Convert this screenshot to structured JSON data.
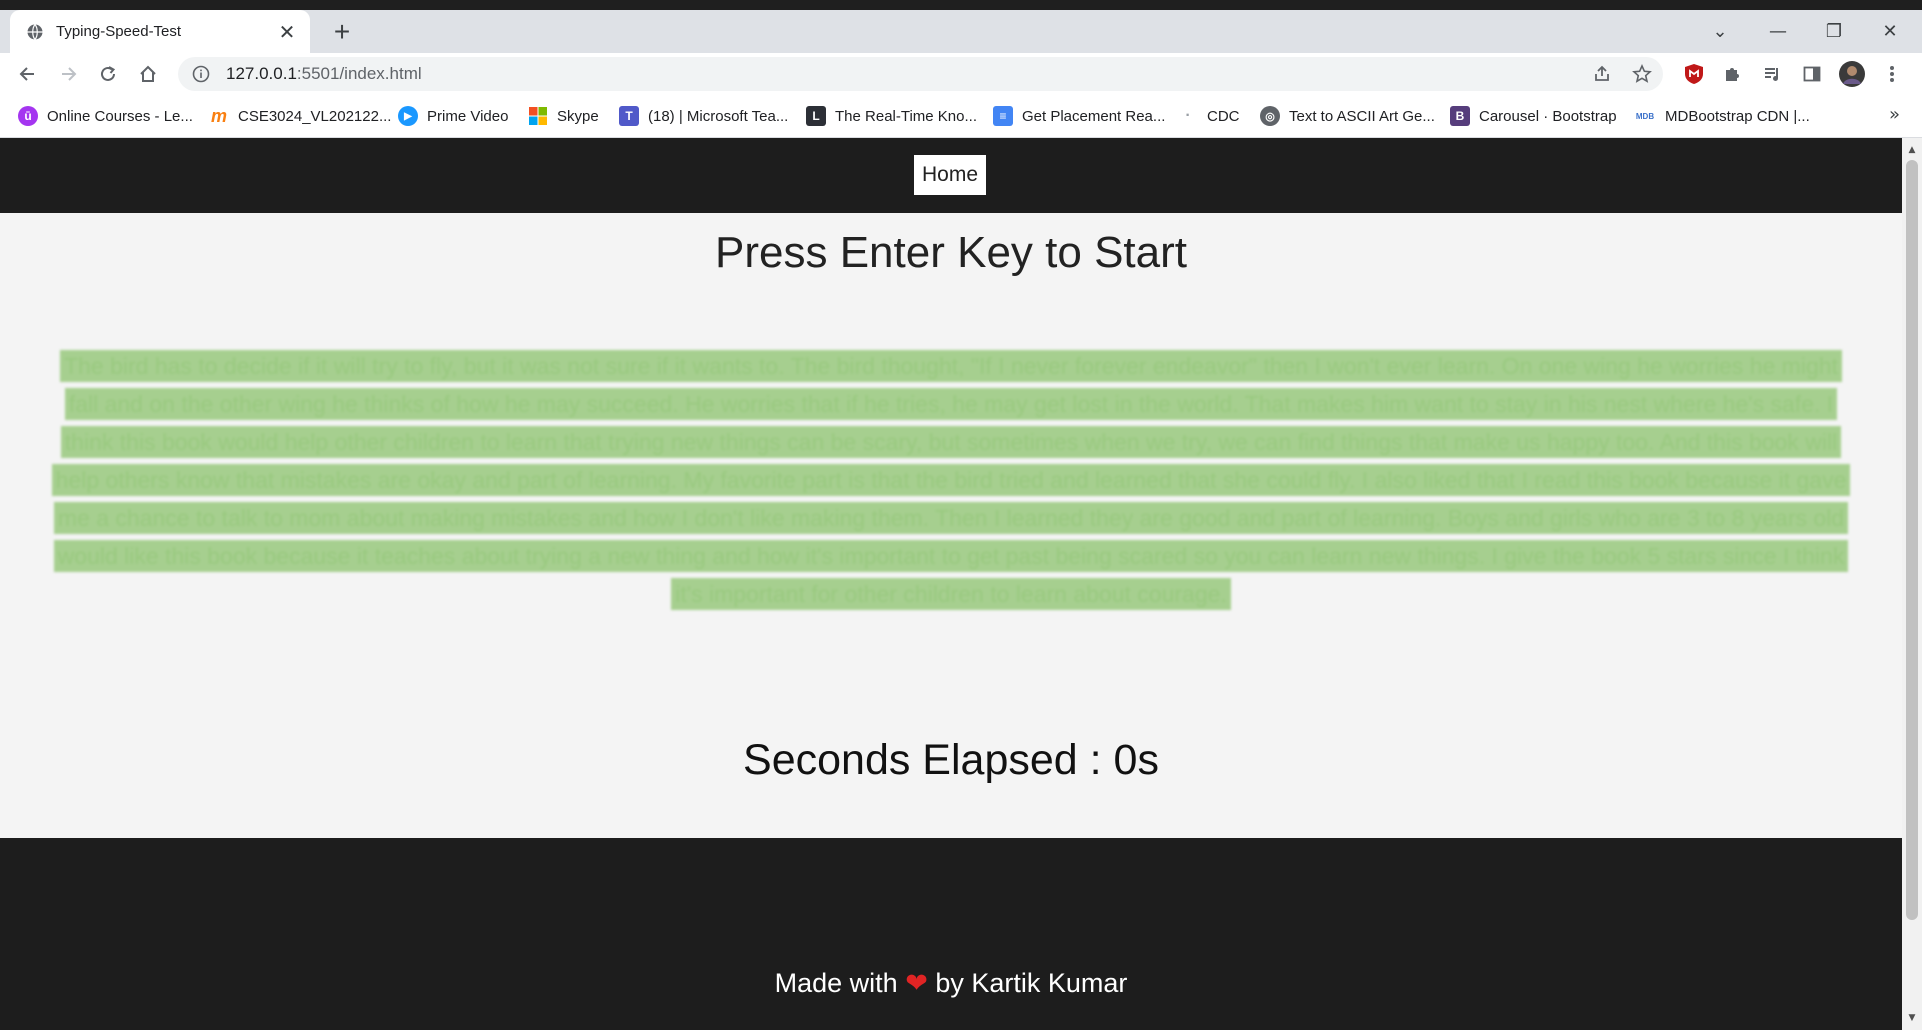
{
  "browser": {
    "tab": {
      "title": "Typing-Speed-Test",
      "close": "✕",
      "new_tab": "+"
    },
    "window_controls": {
      "tab_search": "⌄",
      "minimize": "—",
      "restore": "❐",
      "close": "✕"
    },
    "url": {
      "host": "127.0.0.1",
      "path": ":5501/index.html"
    },
    "bookmarks": [
      {
        "label": "Online Courses - Le...",
        "icon": "udemy-icon",
        "color": "#a435f0",
        "glyph": "ū"
      },
      {
        "label": "CSE3024_VL202122...",
        "icon": "moodle-icon",
        "color": "#f98012",
        "glyph": "m"
      },
      {
        "label": "Prime Video",
        "icon": "prime-video-icon",
        "color": "#1a98ff",
        "glyph": "▶"
      },
      {
        "label": "Skype",
        "icon": "microsoft-icon",
        "color": "#f25022",
        "glyph": ""
      },
      {
        "label": "(18) | Microsoft Tea...",
        "icon": "teams-icon",
        "color": "#5059c9",
        "glyph": "T"
      },
      {
        "label": "The Real-Time Kno...",
        "icon": "lt-icon",
        "color": "#2c2f36",
        "glyph": "L"
      },
      {
        "label": "Get Placement Rea...",
        "icon": "google-docs-icon",
        "color": "#4285f4",
        "glyph": "≡"
      },
      {
        "label": "CDC",
        "icon": "cdc-icon",
        "color": "#9aa0a6",
        "glyph": "·"
      },
      {
        "label": "Text to ASCII Art Ge...",
        "icon": "globe-icon",
        "color": "#5f6368",
        "glyph": "◎"
      },
      {
        "label": "Carousel · Bootstrap",
        "icon": "bootstrap-icon",
        "color": "#563d7c",
        "glyph": "B"
      },
      {
        "label": "MDBootstrap CDN |...",
        "icon": "mdb-icon",
        "color": "#3b71ca",
        "glyph": "MDB"
      }
    ],
    "bookmarks_more": "»"
  },
  "page": {
    "nav": {
      "home_label": "Home"
    },
    "heading": "Press Enter Key to Start",
    "passage": "The bird has to decide if it will try to fly, but it was not sure if it wants to. The bird thought, \"If I never forever endeavor\" then I won't ever learn. On one wing he worries he might fall and on the other wing he thinks of how he may succeed. He worries that if he tries, he may get lost in the world. That makes him want to stay in his nest where he's safe. I think this book would help other children to learn that trying new things can be scary, but sometimes when we try, we can find things that make us happy too. And this book will help others know that mistakes are okay and part of learning. My favorite part is that the bird tried and learned that she could fly. I also liked that I read this book because it gave me a chance to talk to mom about making mistakes and how I don't like making them. Then I learned they are good and part of learning. Boys and girls who are 3 to 8 years old would like this book because it teaches about trying a new thing and how it's important to get past being scared so you can learn new things. I give the book 5 stars since I think it's important for other children to learn about courage.",
    "timer": {
      "label": "Seconds Elapsed : ",
      "value": "0s"
    },
    "footer": {
      "prefix": "Made with ",
      "heart": "❤",
      "suffix": " by Kartik Kumar"
    }
  },
  "colors": {
    "nav_bg": "#1d1d1d",
    "page_bg": "#f4f4f4",
    "passage_highlight": "#a6cf8f",
    "heart": "#e02424"
  }
}
